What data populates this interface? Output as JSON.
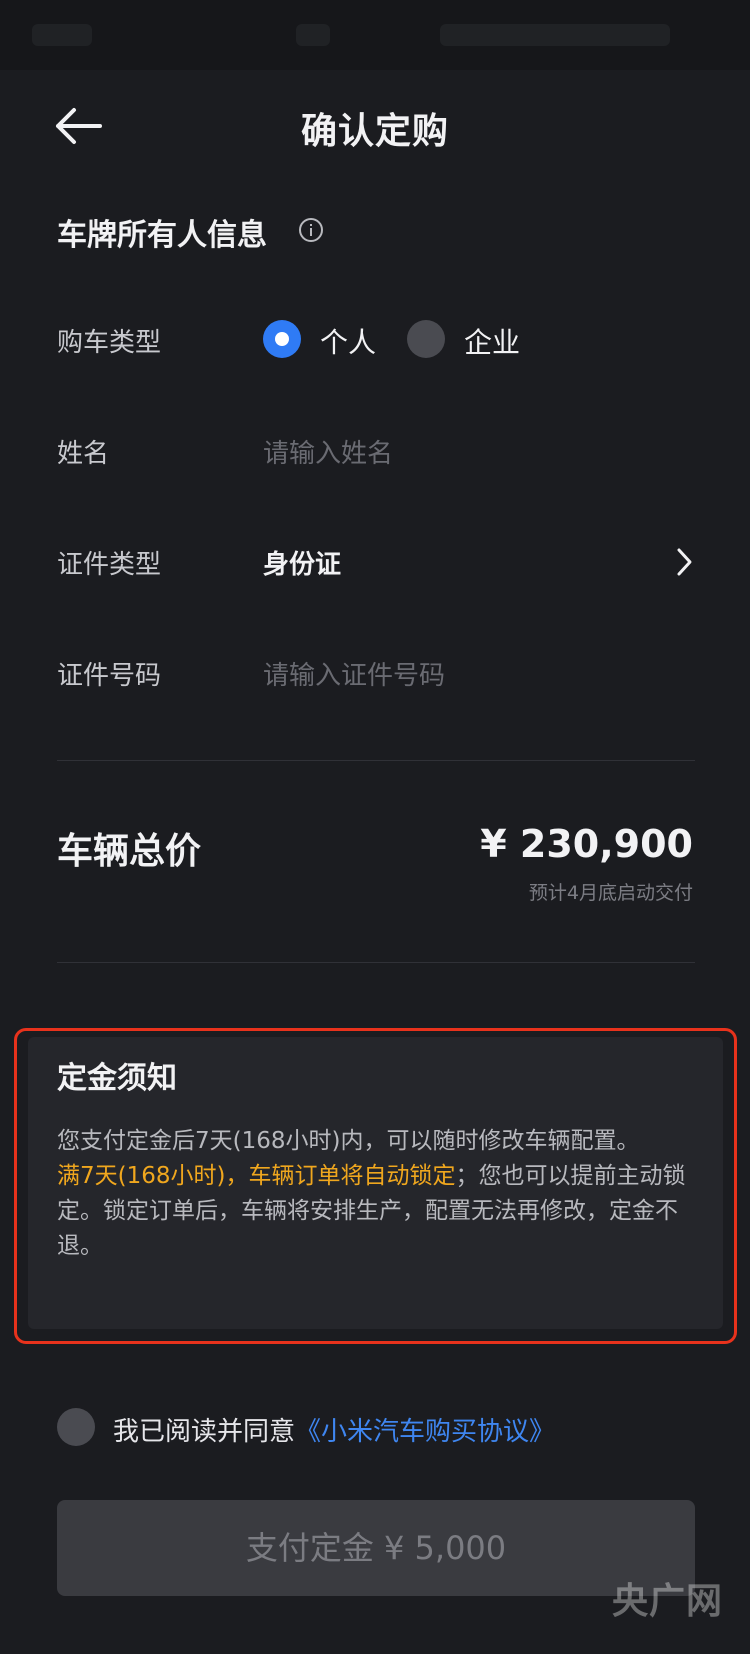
{
  "header": {
    "title": "确认定购"
  },
  "owner_section": {
    "title": "车牌所有人信息"
  },
  "purchase_type": {
    "label": "购车类型",
    "options": [
      {
        "label": "个人",
        "selected": true
      },
      {
        "label": "企业",
        "selected": false
      }
    ]
  },
  "name_field": {
    "label": "姓名",
    "placeholder": "请输入姓名"
  },
  "id_type": {
    "label": "证件类型",
    "value": "身份证"
  },
  "id_number": {
    "label": "证件号码",
    "placeholder": "请输入证件号码"
  },
  "total": {
    "label": "车辆总价",
    "price": "¥ 230,900",
    "delivery_note": "预计4月底启动交付"
  },
  "deposit_notice": {
    "title": "定金须知",
    "line1": "您支付定金后7天(168小时)内，可以随时修改车辆配置。",
    "highlight": "满7天(168小时)，车辆订单将自动锁定",
    "line2": "；您也可以提前主动锁定。锁定订单后，车辆将安排生产，配置无法再修改，定金不退。"
  },
  "agreement": {
    "text": "我已阅读并同意",
    "link": "《小米汽车购买协议》",
    "checked": false
  },
  "pay_button": {
    "label": "支付定金 ¥ 5,000"
  },
  "watermark": {
    "text": "央广网"
  },
  "colors": {
    "background": "#1b1c20",
    "accent_blue": "#2f7bf5",
    "link_blue": "#3f86f0",
    "highlight_orange": "#f0a71e",
    "frame_red": "#e8321c"
  }
}
